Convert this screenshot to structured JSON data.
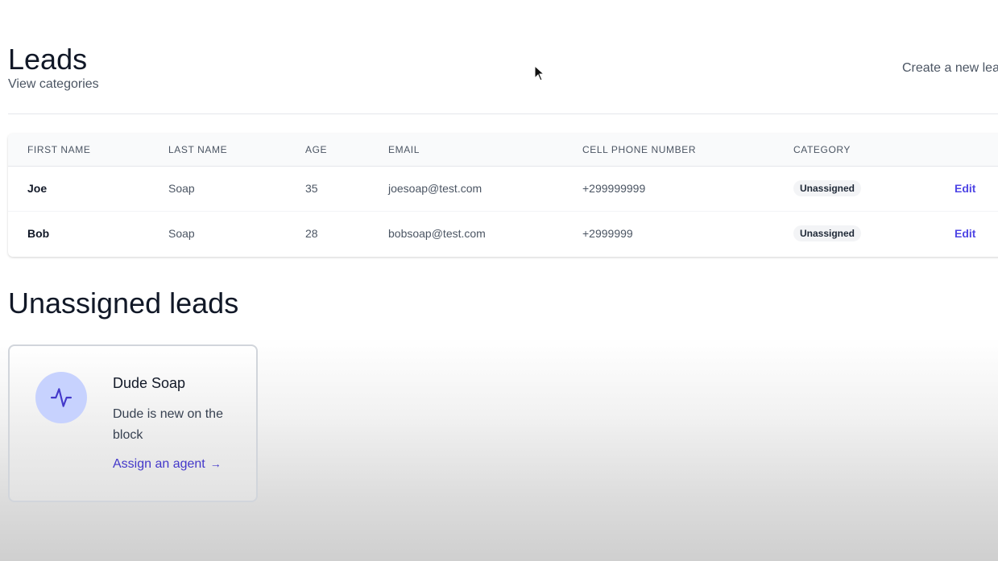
{
  "header": {
    "title": "Leads",
    "view_categories_label": "View categories",
    "create_lead_label": "Create a new lea"
  },
  "table": {
    "columns": [
      "FIRST NAME",
      "LAST NAME",
      "AGE",
      "EMAIL",
      "CELL PHONE NUMBER",
      "CATEGORY"
    ],
    "rows": [
      {
        "first_name": "Joe",
        "last_name": "Soap",
        "age": "35",
        "email": "joesoap@test.com",
        "phone": "+299999999",
        "category": "Unassigned",
        "action": "Edit"
      },
      {
        "first_name": "Bob",
        "last_name": "Soap",
        "age": "28",
        "email": "bobsoap@test.com",
        "phone": "+2999999",
        "category": "Unassigned",
        "action": "Edit"
      }
    ]
  },
  "unassigned": {
    "section_title": "Unassigned leads",
    "cards": [
      {
        "name": "Dude Soap",
        "description": "Dude is new on the block",
        "action_label": "Assign an agent",
        "icon": "activity-icon"
      }
    ]
  },
  "colors": {
    "accent": "#4f46e5",
    "icon_bg": "#c7d2fe",
    "badge_bg": "#f3f4f6"
  }
}
